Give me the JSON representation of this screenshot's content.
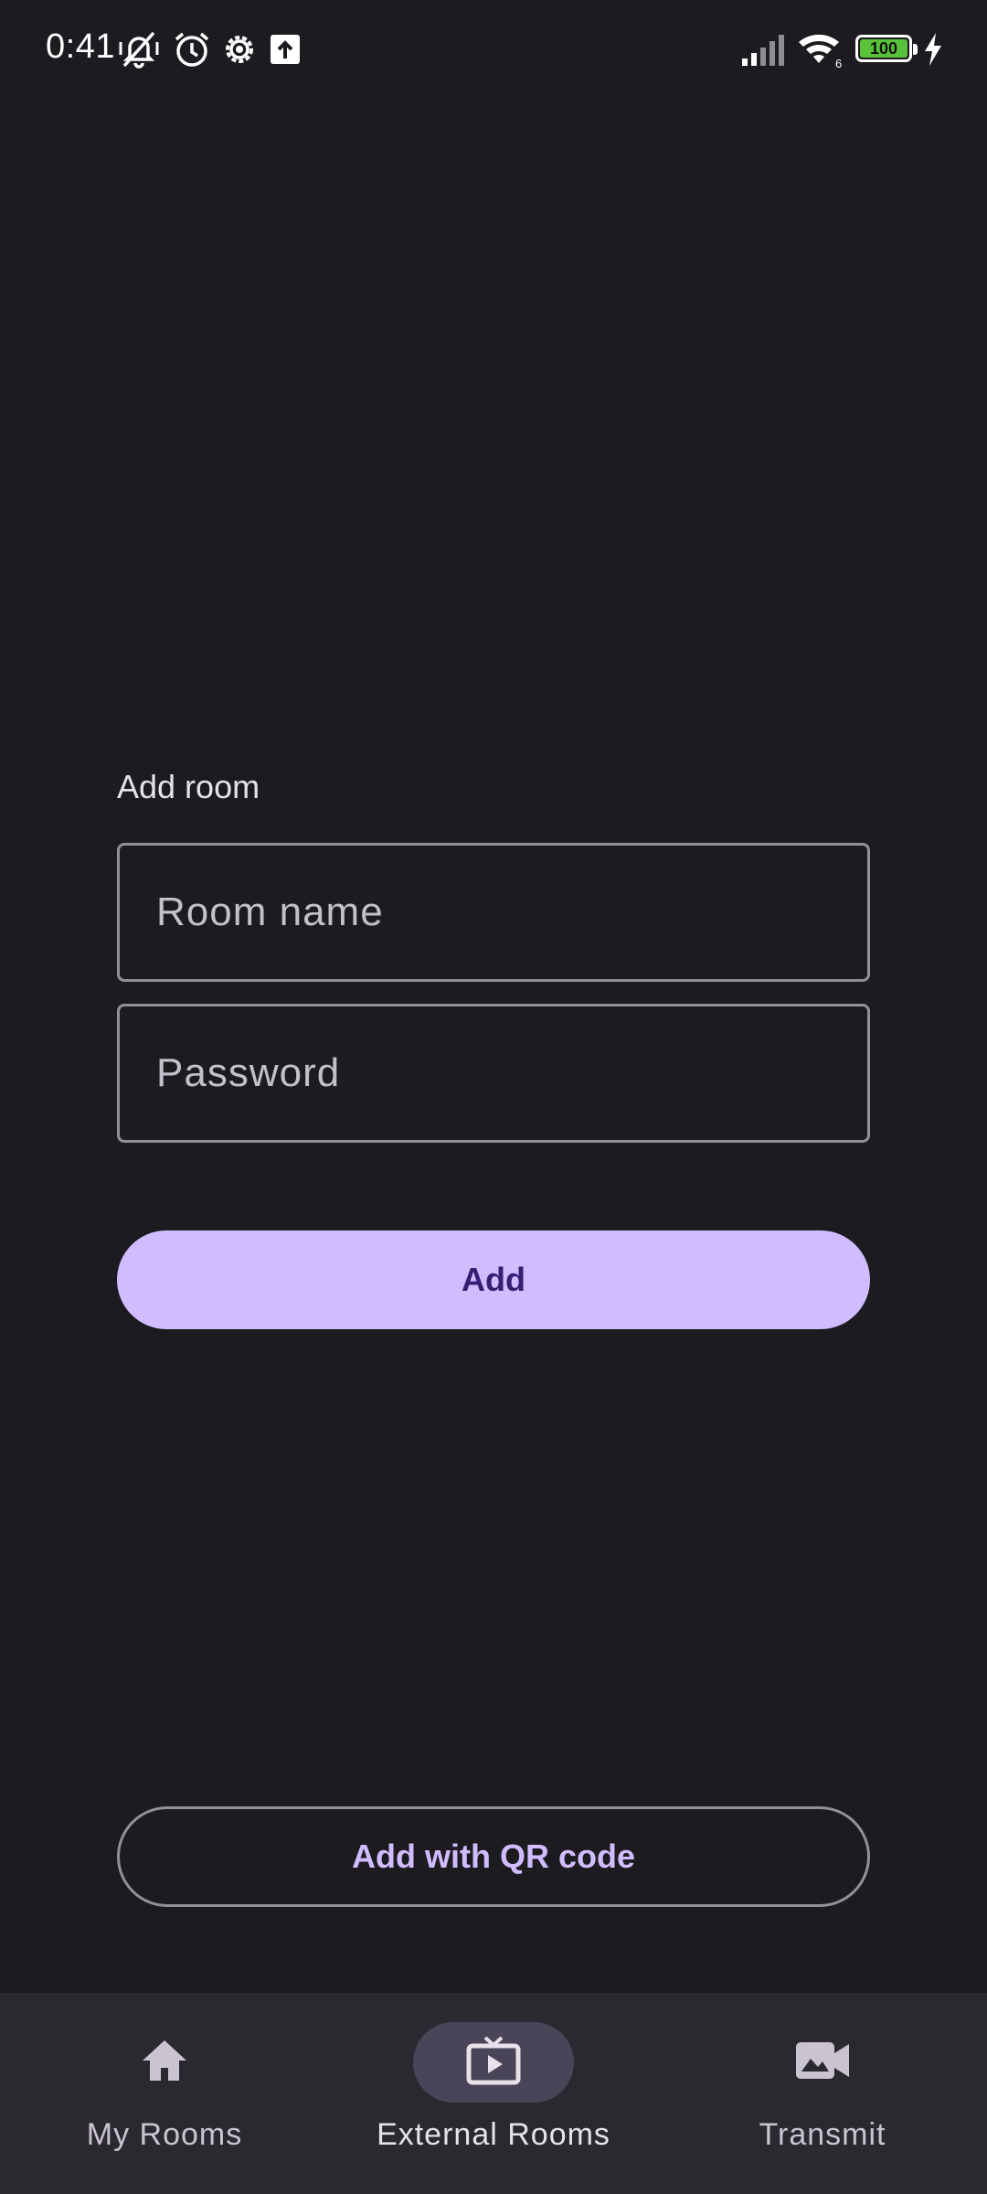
{
  "status_bar": {
    "time": "0:41",
    "battery_level": "100",
    "icons": [
      "mute-vibrate-icon",
      "alarm-icon",
      "settings-icon",
      "upload-icon",
      "signal-icon",
      "wifi-icon",
      "battery-icon",
      "charging-icon"
    ]
  },
  "form": {
    "title": "Add room",
    "room_name_placeholder": "Room name",
    "password_placeholder": "Password",
    "add_label": "Add"
  },
  "qr_button": {
    "label": "Add with QR code"
  },
  "bottom_nav": {
    "items": [
      {
        "label": "My Rooms",
        "icon": "home-icon",
        "active": false
      },
      {
        "label": "External Rooms",
        "icon": "tv-play-icon",
        "active": true
      },
      {
        "label": "Transmit",
        "icon": "video-camera-icon",
        "active": false
      }
    ]
  },
  "colors": {
    "background": "#1c1b20",
    "primary": "#d0bcfe",
    "on_primary": "#371e72",
    "outline": "#948f9a",
    "nav_background": "#2b2930",
    "nav_indicator": "#4a4458",
    "battery_fill": "#57c23a"
  }
}
